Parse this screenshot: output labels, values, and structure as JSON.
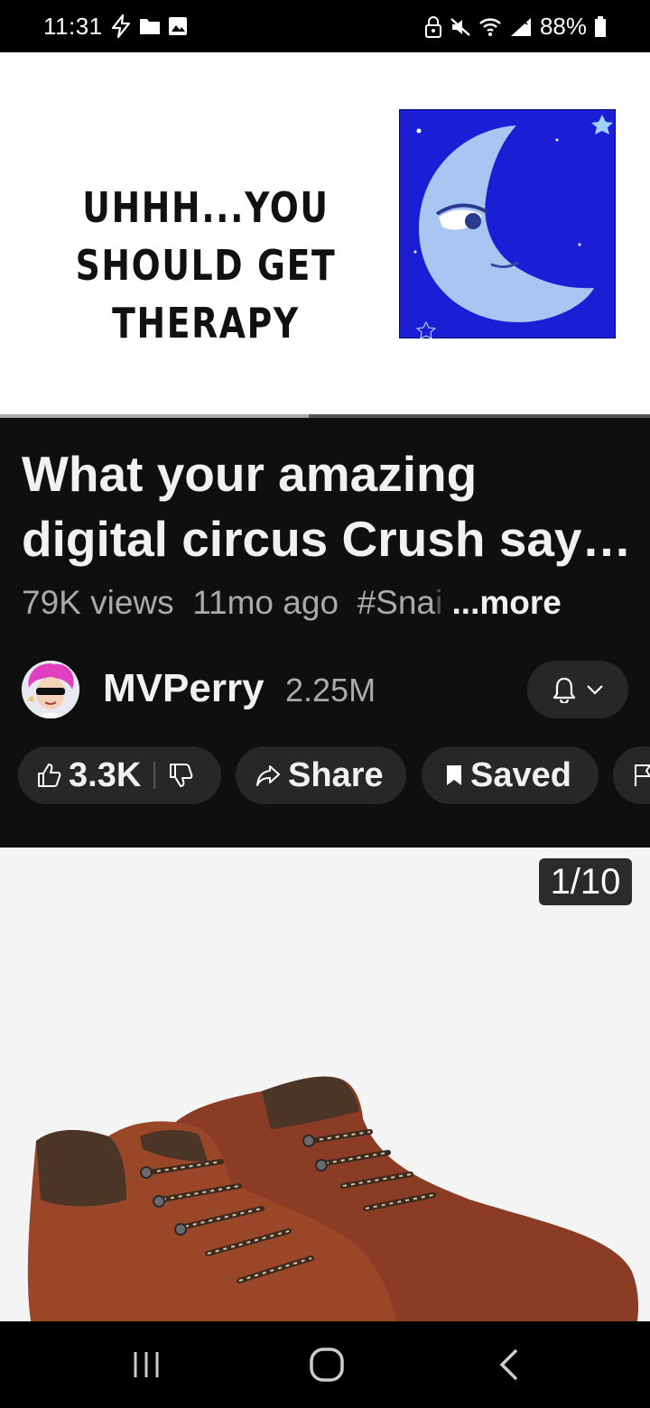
{
  "status_bar": {
    "time": "11:31",
    "battery": "88%"
  },
  "video": {
    "caption": "UHHH...YOU SHOULD GET THERAPY",
    "progress": 0.475
  },
  "details": {
    "title": "What your amazing digital circus Crush say…",
    "views": "79K views",
    "age": "11mo ago",
    "hashtag": "#Sna",
    "hashtag_fade": "i",
    "more": "...more"
  },
  "channel": {
    "name": "MVPerry",
    "subscribers": "2.25M"
  },
  "actions": {
    "likes": "3.3K",
    "share": "Share",
    "saved": "Saved"
  },
  "post": {
    "counter": "1/10"
  },
  "colors": {
    "background": "#0f0f0f",
    "pill": "#272727",
    "moon_bg": "#1a1fd6",
    "boot": "#8a3c24"
  },
  "icons": [
    "lightning-icon",
    "folder-icon",
    "image-icon",
    "lock-icon",
    "mute-icon",
    "wifi-icon",
    "signal-icon",
    "battery-icon",
    "bell-icon",
    "chevron-down-icon",
    "thumbs-up-icon",
    "thumbs-down-icon",
    "share-icon",
    "bookmark-icon",
    "flag-icon",
    "recents-icon",
    "home-icon",
    "back-icon"
  ]
}
